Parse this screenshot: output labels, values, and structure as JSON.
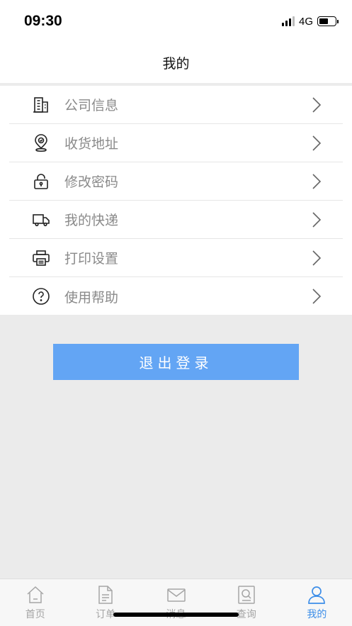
{
  "status": {
    "time": "09:30",
    "network": "4G"
  },
  "header": {
    "title": "我的"
  },
  "menu": {
    "items": [
      {
        "label": "公司信息",
        "icon": "building-icon"
      },
      {
        "label": "收货地址",
        "icon": "location-pin-icon"
      },
      {
        "label": "修改密码",
        "icon": "lock-icon"
      },
      {
        "label": "我的快递",
        "icon": "truck-icon"
      },
      {
        "label": "打印设置",
        "icon": "printer-icon"
      },
      {
        "label": "使用帮助",
        "icon": "help-icon"
      }
    ]
  },
  "logout": {
    "label": "退出登录"
  },
  "tabs": [
    {
      "label": "首页",
      "icon": "home-icon"
    },
    {
      "label": "订单",
      "icon": "document-icon"
    },
    {
      "label": "消息",
      "icon": "mail-icon"
    },
    {
      "label": "查询",
      "icon": "search-icon"
    },
    {
      "label": "我的",
      "icon": "user-icon",
      "active": true
    }
  ],
  "colors": {
    "accent": "#63a5f4",
    "tab_active": "#3d8ee8",
    "tab_inactive": "#a5a5a5",
    "background": "#ebebeb"
  }
}
